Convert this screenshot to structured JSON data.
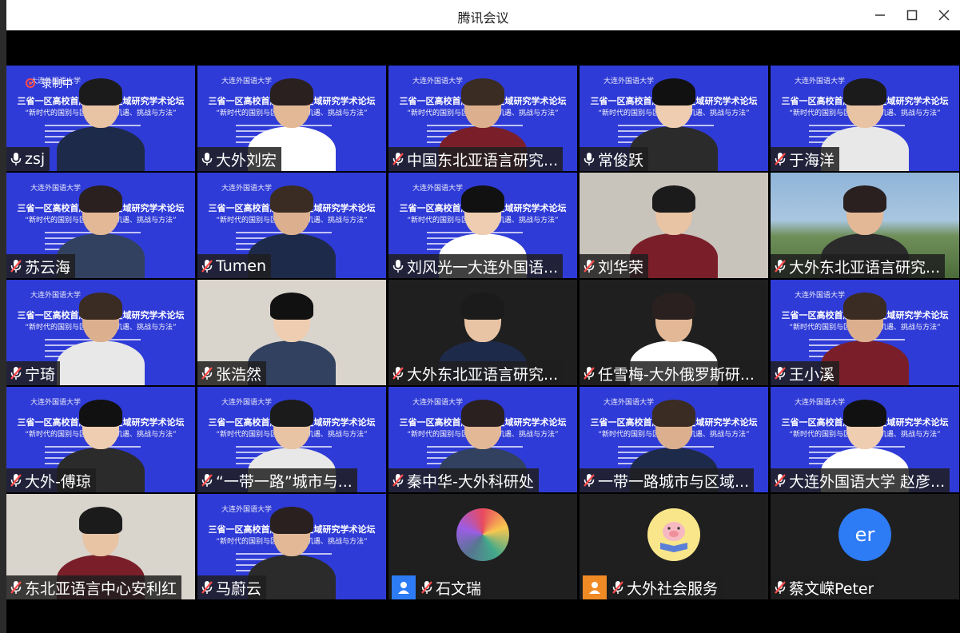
{
  "window": {
    "title": "腾讯会议"
  },
  "recording": {
    "label": "录制中"
  },
  "banner": {
    "logo_text": "大连外国语大学",
    "forum_title": "三省一区高校首届国别与区域研究学术论坛",
    "forum_subtitle": "“新时代的国别与区域研究：机遇、挑战与方法”"
  },
  "participants": [
    {
      "name": "zsj",
      "mic": "on",
      "bg": "blue"
    },
    {
      "name": "大外刘宏",
      "mic": "on",
      "bg": "blue"
    },
    {
      "name": "中国东北亚语言研究...",
      "mic": "muted",
      "bg": "blue"
    },
    {
      "name": "常俊跃",
      "mic": "on",
      "bg": "blue"
    },
    {
      "name": "于海洋",
      "mic": "muted",
      "bg": "blue"
    },
    {
      "name": "苏云海",
      "mic": "muted",
      "bg": "blue"
    },
    {
      "name": "Tumen",
      "mic": "muted",
      "bg": "blue"
    },
    {
      "name": "刘风光一大连外国语...",
      "mic": "on",
      "bg": "blue"
    },
    {
      "name": "刘华荣",
      "mic": "muted",
      "bg": "photo"
    },
    {
      "name": "大外东北亚语言研究...",
      "mic": "muted",
      "bg": "campus"
    },
    {
      "name": "宁琦",
      "mic": "muted",
      "bg": "blue"
    },
    {
      "name": "张浩然",
      "mic": "muted",
      "bg": "wall"
    },
    {
      "name": "大外东北亚语言研究...",
      "mic": "muted",
      "bg": "dark"
    },
    {
      "name": "任雪梅-大外俄罗斯研...",
      "mic": "muted",
      "bg": "dark"
    },
    {
      "name": "王小溪",
      "mic": "muted",
      "bg": "blue"
    },
    {
      "name": "大外-傅琼",
      "mic": "muted",
      "bg": "blue"
    },
    {
      "name": "“一带一路”城市与...",
      "mic": "muted",
      "bg": "blue"
    },
    {
      "name": "秦中华-大外科研处",
      "mic": "muted",
      "bg": "blue"
    },
    {
      "name": "一带一路城市与区域...",
      "mic": "muted",
      "bg": "blue"
    },
    {
      "name": "大连外国语大学 赵彦...",
      "mic": "muted",
      "bg": "blue"
    },
    {
      "name": "东北亚语言中心安利红",
      "mic": "muted",
      "bg": "wall"
    },
    {
      "name": "马蔚云",
      "mic": "muted",
      "bg": "blue"
    },
    {
      "name": "石文瑞",
      "mic": "muted",
      "bg": "avatar",
      "avatar": "image",
      "tag_color": "#2d7cf6"
    },
    {
      "name": "大外社会服务",
      "mic": "muted",
      "bg": "avatar",
      "avatar": "pig",
      "tag_color": "#f08a24"
    },
    {
      "name": "蔡文嵘Peter",
      "mic": "muted",
      "bg": "avatar",
      "avatar": "initials",
      "initials": "er"
    }
  ],
  "colors": {
    "meeting_blue": "#2f3bd6",
    "muted_red": "#ff4b4b",
    "avatar_blue": "#2d7cf6"
  }
}
